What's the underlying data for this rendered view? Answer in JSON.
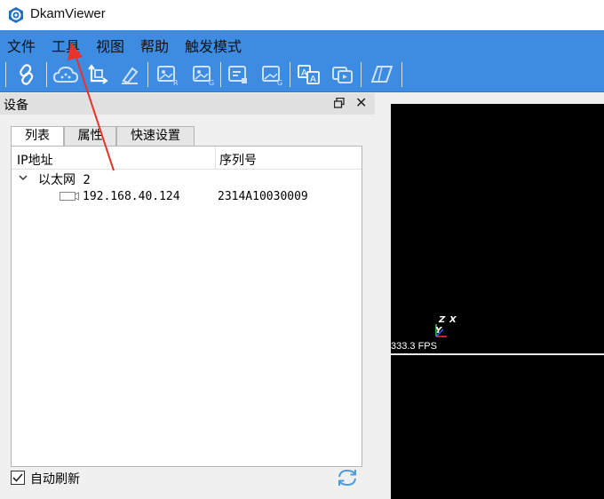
{
  "window": {
    "title": "DkamViewer"
  },
  "menu": [
    {
      "label": "文件"
    },
    {
      "label": "工具"
    },
    {
      "label": "视图"
    },
    {
      "label": "帮助"
    },
    {
      "label": "触发模式"
    }
  ],
  "toolbar": {
    "icons": [
      "link-icon",
      "cloud-icon",
      "coordinate-icon",
      "eraser-icon",
      "image-r-icon",
      "image-g-icon",
      "document-icon",
      "image-save-icon",
      "text-a-icon",
      "stream-icon",
      "plane-icon"
    ]
  },
  "dock": {
    "title": "设备",
    "tabs": [
      {
        "label": "列表"
      },
      {
        "label": "属性"
      },
      {
        "label": "快速设置"
      }
    ],
    "columns": {
      "ip": "IP地址",
      "serial": "序列号"
    },
    "group": {
      "label": "以太网 2"
    },
    "device": {
      "ip": "192.168.40.124",
      "serial": "2314A10030009"
    },
    "auto_refresh": {
      "label": "自动刷新",
      "checked": true
    }
  },
  "viewer": {
    "fps": "333.3 FPS",
    "axes": {
      "z": "Z",
      "x": "X",
      "y": "Y"
    }
  },
  "colors": {
    "menubar": "#3e8ce2",
    "accent": "#2a7fd4",
    "annotation_arrow": "#e8322a"
  }
}
